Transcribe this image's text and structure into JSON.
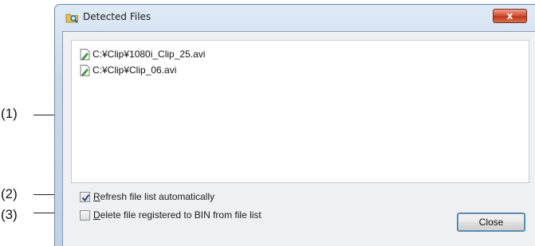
{
  "dialog": {
    "title": "Detected Files",
    "close_glyph": "x",
    "title_icon": "folder-search-icon"
  },
  "file_list": [
    {
      "icon": "video-file-icon",
      "path": "C:¥Clip¥1080i_Clip_25.avi"
    },
    {
      "icon": "video-file-icon",
      "path": "C:¥Clip¥Clip_06.avi"
    }
  ],
  "options": {
    "refresh": {
      "mnemonic": "R",
      "rest": "efresh file list automatically",
      "checked": true
    },
    "delete": {
      "mnemonic": "D",
      "rest": "elete file registered to BIN from file list",
      "checked": false
    }
  },
  "buttons": {
    "close": "Close"
  },
  "callouts": [
    "(1)",
    "(2)",
    "(3)"
  ],
  "colors": {
    "accent": "#48a6e6",
    "close_button_red": "#c0391c",
    "window_frame": "#bed1e8"
  }
}
